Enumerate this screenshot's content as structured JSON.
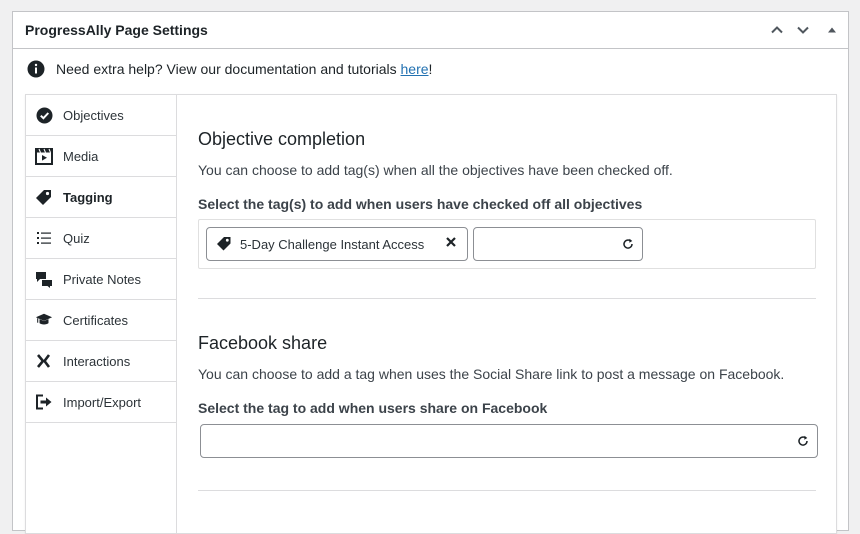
{
  "header": {
    "title": "ProgressAlly Page Settings",
    "actions": [
      "chevron-up-icon",
      "chevron-down-icon",
      "triangle-up-icon"
    ]
  },
  "help": {
    "prefix": "Need extra help? View our documentation and tutorials ",
    "link": "here",
    "suffix": "!"
  },
  "sidebar": {
    "items": [
      {
        "label": "Objectives",
        "icon": "check-circle-icon"
      },
      {
        "label": "Media",
        "icon": "film-icon"
      },
      {
        "label": "Tagging",
        "icon": "tag-icon",
        "active": true
      },
      {
        "label": "Quiz",
        "icon": "list-icon"
      },
      {
        "label": "Private Notes",
        "icon": "chat-bubbles-icon"
      },
      {
        "label": "Certificates",
        "icon": "graduation-cap-icon"
      },
      {
        "label": "Interactions",
        "icon": "interactions-icon"
      },
      {
        "label": "Import/Export",
        "icon": "sign-out-icon"
      }
    ]
  },
  "objective_section": {
    "title": "Objective completion",
    "description": "You can choose to add tag(s) when all the objectives have been checked off.",
    "label": "Select the tag(s) to add when users have checked off all objectives",
    "selected_tag": "5-Day Challenge Instant Access",
    "input_value": ""
  },
  "facebook_section": {
    "title": "Facebook share",
    "description": "You can choose to add a tag when uses the Social Share link to post a message on Facebook.",
    "label": "Select the tag to add when users share on Facebook",
    "input_value": ""
  },
  "colors": {
    "link": "#2271b1",
    "border": "#c3c4c7",
    "text": "#1d2327"
  }
}
